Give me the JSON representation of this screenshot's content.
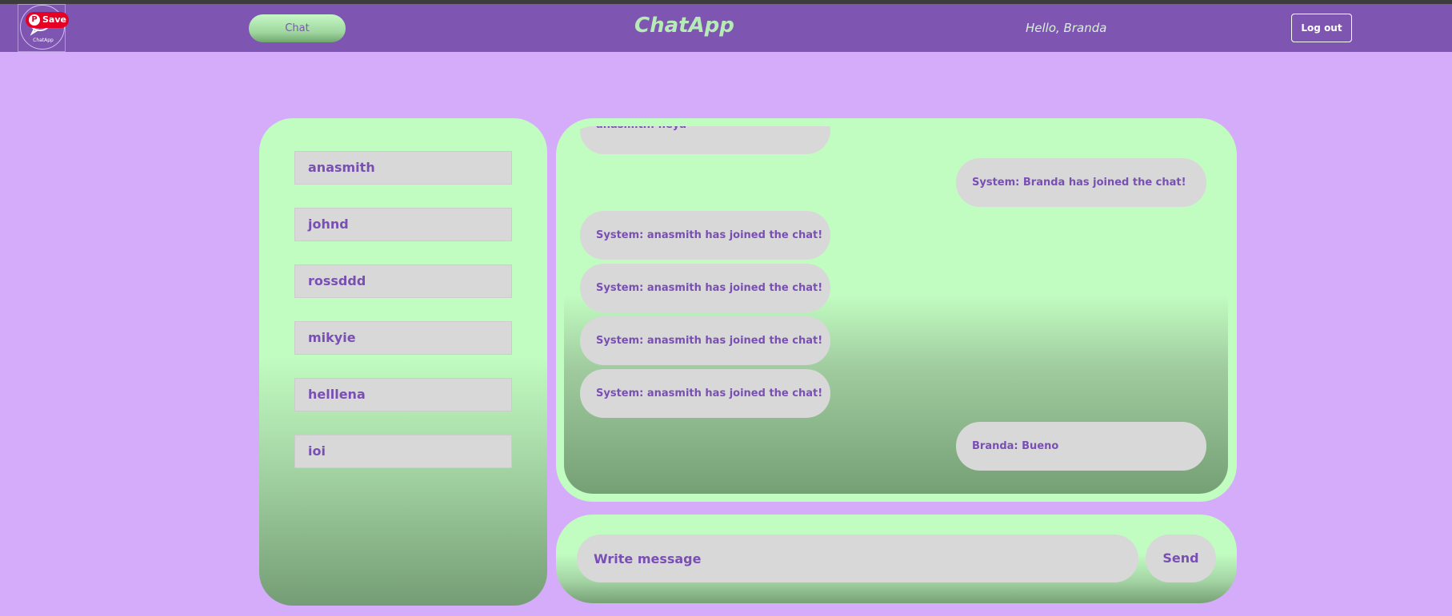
{
  "header": {
    "logo_text": "ChatApp",
    "save_label": "Save",
    "chat_button": "Chat",
    "brand": "ChatApp",
    "greeting": "Hello, Branda",
    "logout_button": "Log out"
  },
  "users": [
    "anasmith",
    "johnd",
    "rossddd",
    "mikyie",
    "helllena",
    "ioi"
  ],
  "messages": [
    "anasmith: heya",
    "System: Branda has joined the chat!",
    "System: anasmith has joined the chat!",
    "System: anasmith has joined the chat!",
    "System: anasmith has joined the chat!",
    "System: anasmith has joined the chat!",
    "Branda: Bueno"
  ],
  "composer": {
    "placeholder": "Write message",
    "send_button": "Send"
  },
  "colors": {
    "navbar": "#7e55b1",
    "background": "#d5acfa",
    "panel_green": "#c1fcc1",
    "bubble": "#d8d8d8",
    "text_purple": "#7a4fb4"
  }
}
